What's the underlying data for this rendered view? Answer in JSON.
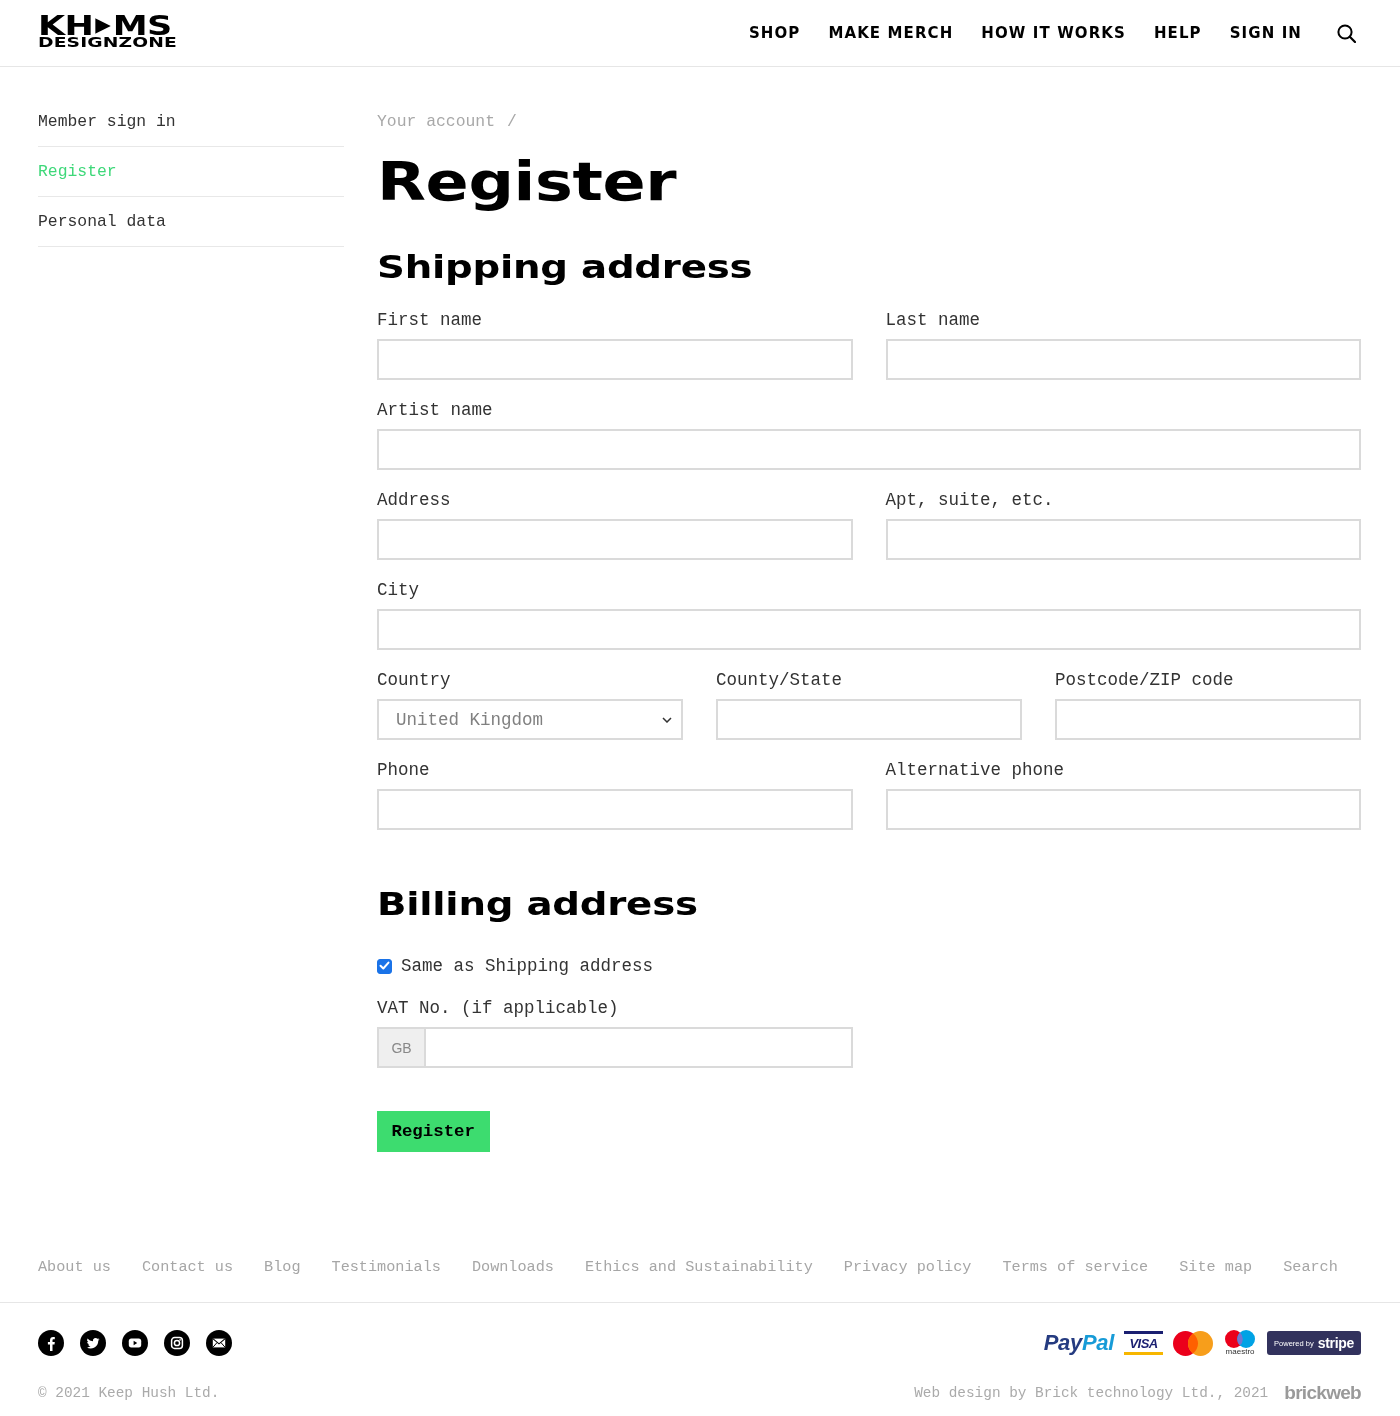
{
  "header": {
    "logo": {
      "left": "KH",
      "right": "MS",
      "bottom": "DESIGNZONE"
    },
    "nav": [
      {
        "label": "SHOP"
      },
      {
        "label": "MAKE MERCH"
      },
      {
        "label": "HOW IT WORKS"
      },
      {
        "label": "HELP"
      },
      {
        "label": "SIGN IN"
      }
    ]
  },
  "sidebar": {
    "items": [
      {
        "label": "Member sign in",
        "selected": false
      },
      {
        "label": "Register",
        "selected": true
      },
      {
        "label": "Personal data",
        "selected": false
      }
    ]
  },
  "breadcrumb": {
    "link": "Your account",
    "separator": "/"
  },
  "page_title": "Register",
  "shipping_address": {
    "heading": "Shipping address",
    "rows": [
      {
        "fields": [
          {
            "kind": "text",
            "label": "First name"
          },
          {
            "kind": "text",
            "label": "Last name"
          }
        ]
      },
      {
        "fields": [
          {
            "kind": "text",
            "label": "Artist name"
          }
        ]
      },
      {
        "fields": [
          {
            "kind": "text",
            "label": "Address"
          },
          {
            "kind": "text",
            "label": "Apt, suite, etc."
          }
        ]
      },
      {
        "fields": [
          {
            "kind": "text",
            "label": "City"
          }
        ]
      },
      {
        "fields": [
          {
            "kind": "select",
            "label": "Country",
            "value": "United Kingdom"
          },
          {
            "kind": "text",
            "label": "County/State"
          },
          {
            "kind": "text",
            "label": "Postcode/ZIP code"
          }
        ]
      },
      {
        "fields": [
          {
            "kind": "text",
            "label": "Phone"
          },
          {
            "kind": "text",
            "label": "Alternative phone"
          }
        ]
      }
    ]
  },
  "billing_address": {
    "heading": "Billing address",
    "same_as_shipping": {
      "label": "Same as Shipping address",
      "checked": true
    },
    "vat": {
      "label": "VAT No. (if applicable)",
      "prefix": "GB"
    }
  },
  "submit_button": "Register",
  "footer": {
    "links": [
      "About us",
      "Contact us",
      "Blog",
      "Testimonials",
      "Downloads",
      "Ethics and Sustainability",
      "Privacy policy",
      "Terms of service",
      "Site map",
      "Search"
    ],
    "social": [
      {
        "kind": "facebook"
      },
      {
        "kind": "twitter"
      },
      {
        "kind": "youtube"
      },
      {
        "kind": "instagram"
      },
      {
        "kind": "email"
      }
    ],
    "payment_logos": [
      {
        "kind": "paypal",
        "parts": [
          "Pay",
          "Pal"
        ]
      },
      {
        "kind": "visa",
        "text": "VISA"
      },
      {
        "kind": "mastercard"
      },
      {
        "kind": "maestro",
        "text": "maestro"
      },
      {
        "kind": "stripe",
        "text": "Powered by **stripe**"
      }
    ],
    "copyright": "© 2021 Keep Hush Ltd.",
    "credit": "Web design by Brick technology Ltd., 2021",
    "credit_logo": "brickweb"
  }
}
